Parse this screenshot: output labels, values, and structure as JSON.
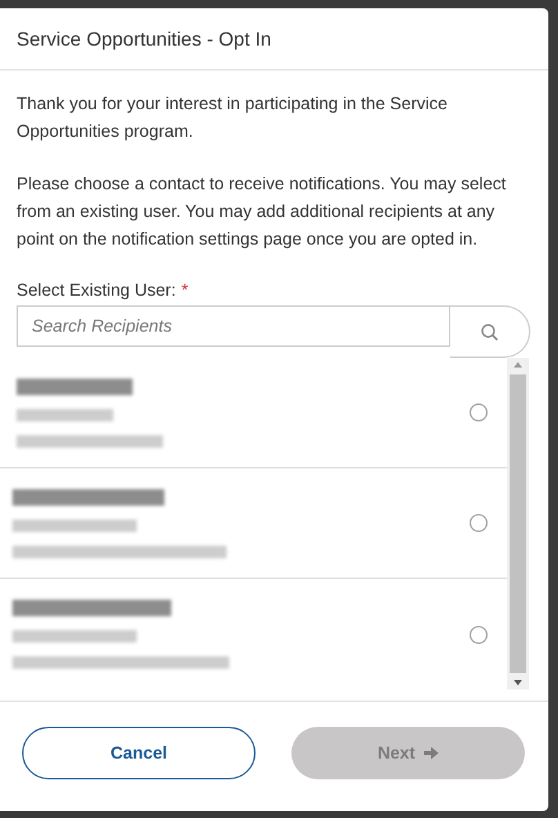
{
  "dialog": {
    "title": "Service Opportunities - Opt In"
  },
  "paragraphs": [
    "Thank you for your interest in participating in the Service Opportunities program.",
    "Please choose a contact to receive notifications. You may select from an existing user. You may add additional recipients at any point on the notification settings page once you are opted in."
  ],
  "field": {
    "label": "Select Existing User:",
    "required_mark": "*",
    "placeholder": "Search Recipients"
  },
  "recipients": [
    {
      "selected": false
    },
    {
      "selected": false
    },
    {
      "selected": false
    }
  ],
  "buttons": [
    {
      "label": "Cancel",
      "kind": "secondary"
    },
    {
      "label": "Next",
      "kind": "primary",
      "disabled": true
    }
  ]
}
